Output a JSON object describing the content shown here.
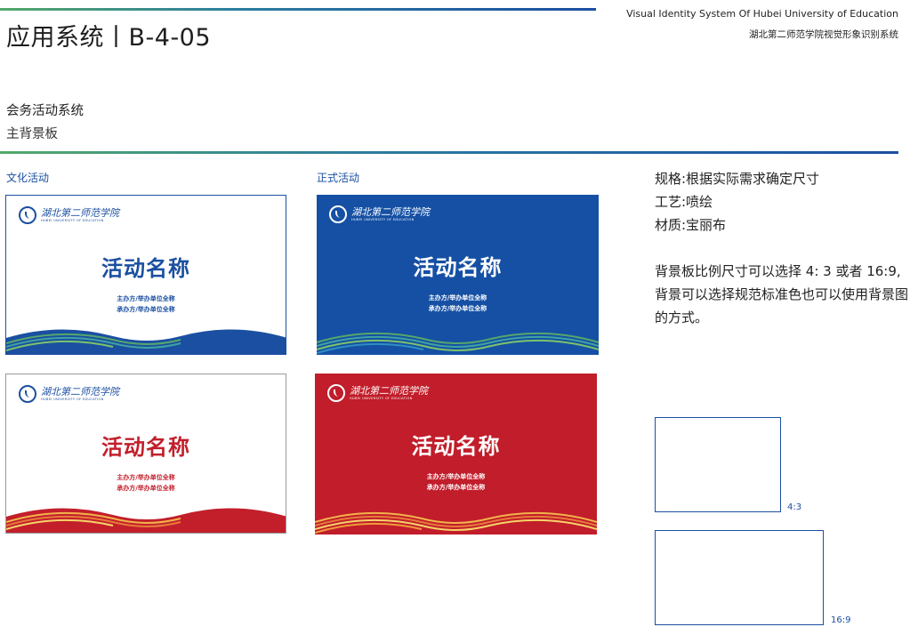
{
  "header": {
    "title": "应用系统丨B-4-05",
    "brand_en": "Visual Identity System Of Hubei University of Education",
    "brand_cn": "湖北第二师范学院视觉形象识别系统"
  },
  "section": {
    "title": "会务活动系统",
    "subtitle": "主背景板"
  },
  "captions": {
    "cultural": "文化活动",
    "formal": "正式活动"
  },
  "board": {
    "logo_cn": "湖北第二师范学院",
    "logo_en": "HUBEI UNIVERSITY OF EDUCATION",
    "name": "活动名称",
    "host_line1": "主办方/举办单位全称",
    "host_line2": "承办方/举办单位全称"
  },
  "boards": [
    {
      "style": "white-blue",
      "bg": "#ffffff",
      "accent": "#1b4fa1"
    },
    {
      "style": "blue",
      "bg": "#1550a4",
      "accent": "#ffffff"
    },
    {
      "style": "white-red",
      "bg": "#ffffff",
      "accent": "#c21f2b"
    },
    {
      "style": "red",
      "bg": "#c11d2a",
      "accent": "#ffffff"
    }
  ],
  "spec": {
    "size": "规格:根据实际需求确定尺寸",
    "craft": "工艺:喷绘",
    "material": "材质:宝丽布"
  },
  "description": "背景板比例尺寸可以选择 4: 3 或者 16:9, 背景可以选择规范标准色也可以使用背景图的方式。",
  "ratios": {
    "r43": "4:3",
    "r169": "16:9"
  },
  "colors": {
    "brand_blue": "#1b4fa1",
    "brand_red": "#c21f2b",
    "brand_green": "#54a86b"
  }
}
